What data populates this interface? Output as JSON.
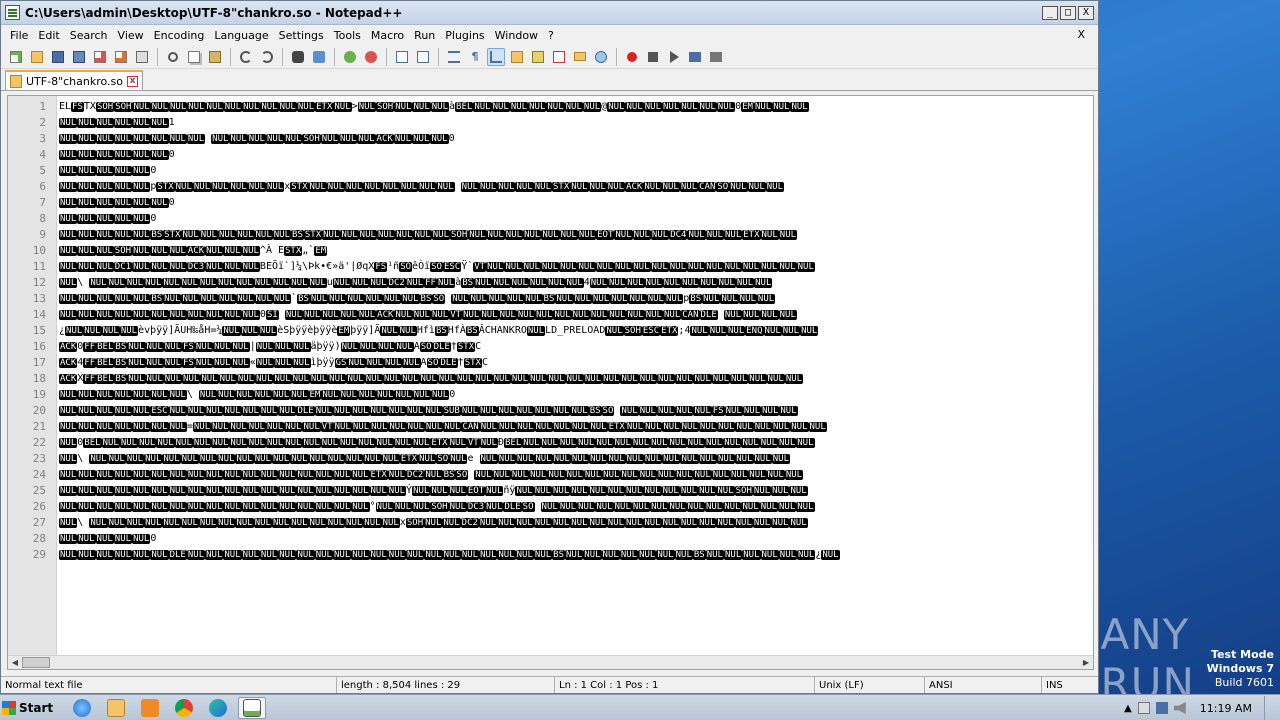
{
  "window": {
    "title": "C:\\Users\\admin\\Desktop\\UTF-8\"chankro.so - Notepad++",
    "min": "_",
    "max": "□",
    "close": "X"
  },
  "menu": {
    "items": [
      "File",
      "Edit",
      "Search",
      "View",
      "Encoding",
      "Language",
      "Settings",
      "Tools",
      "Macro",
      "Run",
      "Plugins",
      "Window",
      "?"
    ],
    "close": "X"
  },
  "tab": {
    "label": "UTF-8\"chankro.so",
    "close": "x"
  },
  "editor": {
    "line_numbers": [
      "1",
      "2",
      "3",
      "4",
      "5",
      "6",
      "7",
      "8",
      "9",
      "10",
      "11",
      "12",
      "13",
      "14",
      "15",
      "16",
      "17",
      "18",
      "19",
      "20",
      "21",
      "22",
      "23",
      "24",
      "25",
      "26",
      "27",
      "28",
      "29"
    ],
    "lines": [
      "ELFSTXSOHSOHNULNULNULNULNULNULNULNULNULNULETXNUL>NULSOHNULNULNULàBELNULNULNULNULNULNULNUL@NULNULNULNULNULNULNUL0EMNULNULNUL",
      "NULNULNULNULNULNUL1",
      "NULNULNULNULNULNULNULNUL NULNULNULNULNULSOHNULNULNULACKNULNULNUL0",
      "NULNULNULNULNULNUL0",
      " NULNULNULNULNUL0",
      " NULNULNULNULNULpSTXNULNULNULNULNULNULxSTXNULNULNULNULNULNULNULNUL NULNULNULNULNULSTXNULNULNULACKNULNULNULCANSONULNULNUL",
      "NULNULNULNULNULNUL0",
      " NULNULNULNULNUL0",
      " NULNULNULNULNULBSSTXNULNULNULNULNULNULBSSTXNULNULNULNULNULNULNULSOHNULNULNULNULNULNULNULEOTNULNULNULDC4NULNULNULETXNULNUL",
      "NULNULNULSOHNULNULNULACKNULNULNUL^À ESTX„`EM",
      "NULNULNULDC1NULNULNULDC3NULNULNULBEÕï`]¼\\Þk•€»ä'|ØqXFS¹ñSOêÒïSOESCŸ`VTNULNULNULNULNULNULNULNULNULNULNULNULNULNULNULNULNULNUL",
      "NUL\\    NULNULNULNULNULNULNULNULNULNULNULNULNULuNULNULNULDC2NULFFNULàBSNULNULNULNULNULNUL4NULNULNULNULNULNULNULNULNULNUL",
      " NULNULNULNULNULBSNULNULNULNULNULNULNUL`BSNULNULNULNULNULNULBSSO NULNULNULNULNULBSNULNULNULNULNULNULNULpBSNULNULNULNUL",
      "NULNULNULNULNULNULNULNULNULNULNUL0SI NULNULNULNULNULACKNULNULNULVTNULNULNULNULNULNULNULNULNULNULNULNULCANDLE NULNULNULNUL",
      "¿NULNULNULNULèvþÿÿ]ÃUH‰åH=¼NULNULNULèSþÿÿèþÿÿèEMþÿÿ]ÃNULNULHfìBSHfÀBSÂCHANKRONULLD_PRELOADNULSOHESCETX;4NULNULNULENQNULNULNUL",
      "ACK0FFBELBSNULNULNULFSNULNULNUL|NULNULNULäþÿÿ)NULNULNULNULASODLE†STXC",
      "ACK4FFBELBSNULNULNULFSNULNULNUL«NULNULNULìþÿÿGSNULNULNULNULASODLE†STXC",
      "ACKXFFBELBSNULNULNULNULNULNULNULNULNULNULNULNULNULNULNULNULNULNULNULNULNULNULNULNULNULNULNULNULNULNULNULNULNULNULNULNULNUL",
      "NULNULNULNULNULNULNUL\\    NULNULNULNULNULNULEMNULNULNULNULNULNULNUL0",
      " NULNULNULNULNULESCNULNULNULNULNULNULNULDLENULNULNULNULNULNULNULSUBNULNULNULNULNULNULNULBSSO NULNULNULNULNULFSNULNULNULNUL",
      "NULNULNULNULNULNULNUL=NULNULNULNULNULNULNULVTNULNULNULNULNULNULNULCANNULNULNULNULNULNULNULETXNULNULNULNULNULNULNULNULNULNULNUL",
      "NUL0BELNULNULNULNULNULNULNULNULNULNULNULNULNULNULNULNULNULNULETXNULVTNULÐBELNULNULNULNULNULNULNULNULNULNULNULNULNULNULNULNUL",
      "NUL\\    NULNULNULNULNULNULNULNULNULNULNULNULNULNULNULNULNULETXNULSONULe NULNULNULNULNULNULNULNULNULNULNULNULNULNULNULNULNUL",
      " NULNULNULNULNULNULNULNULNULNULNULNULNULNULNULNULNULETXNULDC2NULBSSO NULNULNULNULNULNULNULNULNULNULNULNULNULNULNULNULNULNUL",
      " NULNULNULNULNULNULNULNULNULNULNULNULNULNULNULNULNULNULNULÝNULNULNULEOTNULñÿNULNULNULNULNULNULNULNULNULNULNULNULSOHNULNULNUL",
      "NULNULNULNULNULNULNULNULNULNULNULNULNULNULNULNULNUL°NULNULNULSOHNULDC3NULDLESO NULNULNULNULNULNULNULNULNULNULNULNULNULNULNUL",
      "NUL\\    NULNULNULNULNULNULNULNULNULNULNULNULNULNULNULNULNULxSOHNULNULDC2NULNULNULNULNULNULNULNULNULNULNULNULNULNULNULNULNULNUL",
      " NULNULNULNULNUL0",
      "NULNULNULNULNULNULDLENULNULNULNULNULNULNULNULNULNULNULNULNULNULNULNULNULNULNULNULBSNULNULNULNULNULNULNULBSNULNULNULNULNULNUL¿NUL"
    ]
  },
  "status": {
    "filetype": "Normal text file",
    "length": "length : 8,504    lines : 29",
    "position": "Ln : 1    Col : 1    Pos : 1",
    "eol": "Unix (LF)",
    "encoding": "ANSI",
    "mode": "INS"
  },
  "taskbar": {
    "start": "Start",
    "clock": "11:19 AM"
  },
  "desktop": {
    "watermark": "ANY RUN",
    "testmode_line1": "Test Mode",
    "testmode_line2": "Windows 7",
    "testmode_line3": "Build 7601"
  },
  "colors": {
    "control_char_bg": "#000000",
    "control_char_fg": "#ffffff",
    "tab_accent": "#f3a83b"
  }
}
